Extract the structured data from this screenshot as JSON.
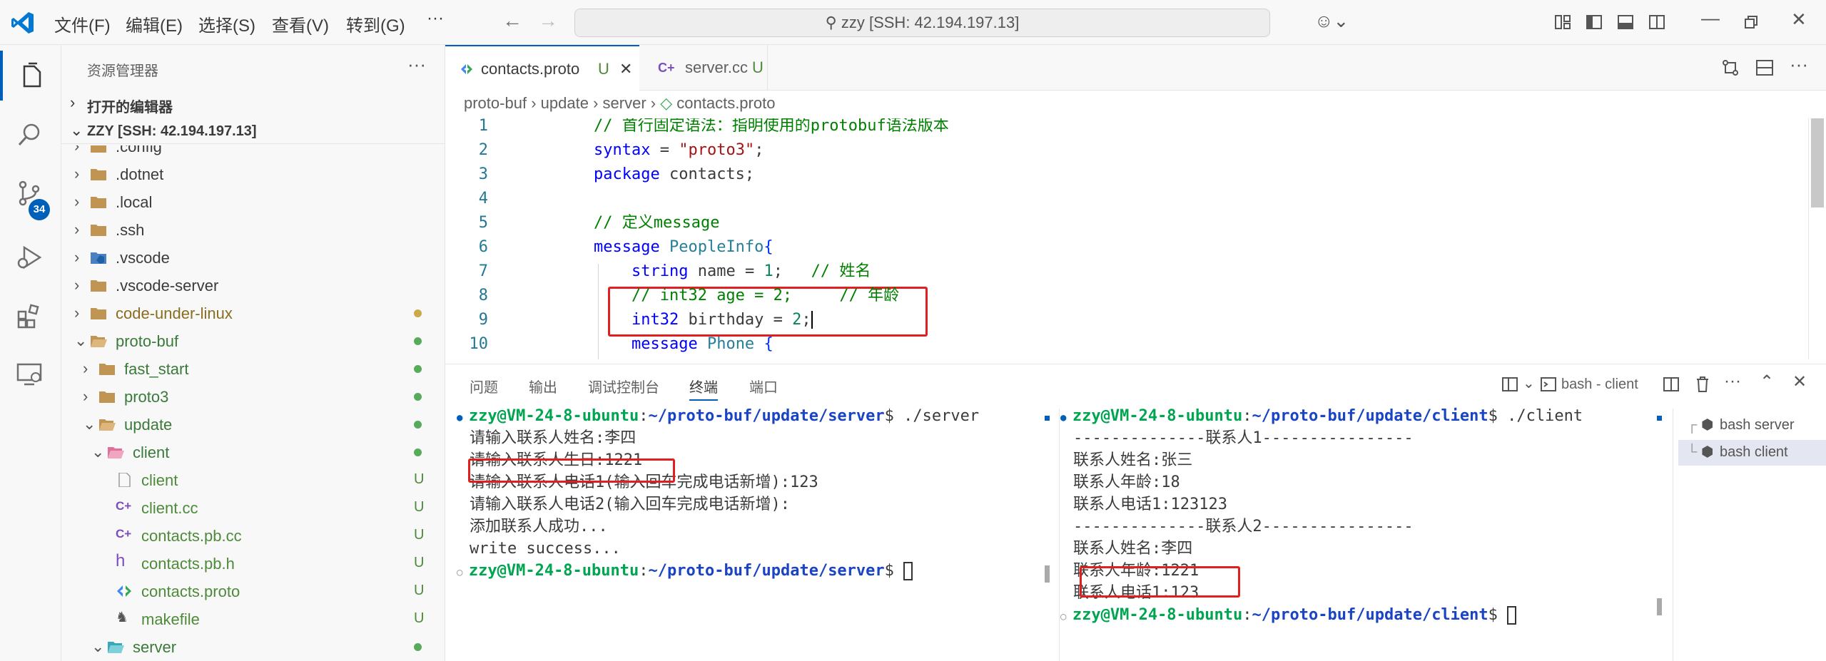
{
  "titlebar": {
    "menus": [
      "文件(F)",
      "编辑(E)",
      "选择(S)",
      "查看(V)",
      "转到(G)"
    ],
    "more": "···",
    "search": "zzy [SSH: 42.194.197.13]"
  },
  "activity": {
    "scm_badge": "34"
  },
  "sidebar": {
    "title": "资源管理器",
    "more": "···",
    "open_editors": "打开的编辑器",
    "workspace": "ZZY [SSH: 42.194.197.13]",
    "items": [
      {
        "name": ".config",
        "kind": "folder",
        "indent": 0,
        "chev": "›",
        "status": ""
      },
      {
        "name": ".dotnet",
        "kind": "folder",
        "indent": 0,
        "chev": "›",
        "status": ""
      },
      {
        "name": ".local",
        "kind": "folder",
        "indent": 0,
        "chev": "›",
        "status": ""
      },
      {
        "name": ".ssh",
        "kind": "folder",
        "indent": 0,
        "chev": "›",
        "status": ""
      },
      {
        "name": ".vscode",
        "kind": "vscode",
        "indent": 0,
        "chev": "›",
        "status": ""
      },
      {
        "name": ".vscode-server",
        "kind": "folder",
        "indent": 0,
        "chev": "›",
        "status": ""
      },
      {
        "name": "code-under-linux",
        "kind": "folder",
        "indent": 0,
        "chev": "›",
        "status": "dot-yellow"
      },
      {
        "name": "proto-buf",
        "kind": "folder-open",
        "indent": 0,
        "chev": "⌄",
        "status": "dot-green"
      },
      {
        "name": "fast_start",
        "kind": "folder",
        "indent": 1,
        "chev": "›",
        "status": "dot-green"
      },
      {
        "name": "proto3",
        "kind": "folder",
        "indent": 1,
        "chev": "›",
        "status": "dot-green"
      },
      {
        "name": "update",
        "kind": "folder-open",
        "indent": 1,
        "chev": "⌄",
        "status": "dot-green"
      },
      {
        "name": "client",
        "kind": "client-folder",
        "indent": 2,
        "chev": "⌄",
        "status": "dot-green"
      },
      {
        "name": "client",
        "kind": "file",
        "indent": 3,
        "chev": "",
        "status": "U"
      },
      {
        "name": "client.cc",
        "kind": "cpp",
        "indent": 3,
        "chev": "",
        "status": "U"
      },
      {
        "name": "contacts.pb.cc",
        "kind": "cpp",
        "indent": 3,
        "chev": "",
        "status": "U"
      },
      {
        "name": "contacts.pb.h",
        "kind": "h",
        "indent": 3,
        "chev": "",
        "status": "U"
      },
      {
        "name": "contacts.proto",
        "kind": "proto",
        "indent": 3,
        "chev": "",
        "status": "U"
      },
      {
        "name": "makefile",
        "kind": "makefile",
        "indent": 3,
        "chev": "",
        "status": "U"
      },
      {
        "name": "server",
        "kind": "server-folder",
        "indent": 2,
        "chev": "⌄",
        "status": "dot-green"
      }
    ]
  },
  "tabs": [
    {
      "label": "contacts.proto",
      "flag": "U",
      "close": "✕"
    },
    {
      "label": "server.cc",
      "flag": "U",
      "close": ""
    }
  ],
  "breadcrumb": [
    "proto-buf",
    "update",
    "server",
    "contacts.proto"
  ],
  "code": [
    {
      "n": "1",
      "html": "<span class='cm'>// 首行固定语法：指明使用的protobuf语法版本</span>"
    },
    {
      "n": "2",
      "html": "<span class='kw'>syntax</span> = <span class='st'>\"proto3\"</span>;"
    },
    {
      "n": "3",
      "html": "<span class='kw'>package</span> contacts;"
    },
    {
      "n": "4",
      "html": ""
    },
    {
      "n": "5",
      "html": "<span class='cm'>// 定义message</span>"
    },
    {
      "n": "6",
      "html": "<span class='kw'>message</span> <span class='ty'>PeopleInfo</span><span class='br'>{</span>"
    },
    {
      "n": "7",
      "html": "    <span class='kw'>string</span> name = <span class='nu'>1</span>;   <span class='cm'>// 姓名</span>"
    },
    {
      "n": "8",
      "html": "    <span class='cm'>// int32 age = 2;     // 年龄</span>"
    },
    {
      "n": "9",
      "html": "    <span class='kw'>int32</span> birthday = <span class='nu'>2</span>;<span style='border-left:2px solid #000'></span>"
    },
    {
      "n": "10",
      "html": "    <span class='kw'>message</span> <span class='ty'>Phone</span> <span class='br'>{</span>"
    }
  ],
  "panel": {
    "tabs": [
      "问题",
      "输出",
      "调试控制台",
      "终端",
      "端口"
    ],
    "active_tab": "终端",
    "terminal_name": "bash - client",
    "terminals": [
      "bash  server",
      "bash  client"
    ]
  },
  "term_left": [
    {
      "prompt_user": "zzy@VM-24-8-ubuntu",
      "prompt_path": "~/proto-buf/update/server",
      "cmd": "$ ./server"
    },
    {
      "text": "请输入联系人姓名:李四"
    },
    {
      "text": "请输入联系人生日:1221"
    },
    {
      "text": "请输入联系人电话1(输入回车完成电话新增):123"
    },
    {
      "text": "请输入联系人电话2(输入回车完成电话新增):"
    },
    {
      "text": "添加联系人成功..."
    },
    {
      "text": "write success..."
    },
    {
      "prompt_user": "zzy@VM-24-8-ubuntu",
      "prompt_path": "~/proto-buf/update/server",
      "cmd": "$ "
    }
  ],
  "term_right": [
    {
      "prompt_user": "zzy@VM-24-8-ubuntu",
      "prompt_path": "~/proto-buf/update/client",
      "cmd": "$ ./client"
    },
    {
      "text": "--------------联系人1----------------"
    },
    {
      "text": "联系人姓名:张三"
    },
    {
      "text": "联系人年龄:18"
    },
    {
      "text": "联系人电话1:123123"
    },
    {
      "text": "--------------联系人2----------------"
    },
    {
      "text": "联系人姓名:李四"
    },
    {
      "text": "联系人年龄:1221"
    },
    {
      "text": "联系人电话1:123"
    },
    {
      "prompt_user": "zzy@VM-24-8-ubuntu",
      "prompt_path": "~/proto-buf/update/client",
      "cmd": "$ "
    }
  ],
  "colors": {
    "accent": "#005fb8",
    "highlight": "#e02020",
    "git_green": "#57ab5a",
    "git_yellow": "#c9a94a"
  }
}
